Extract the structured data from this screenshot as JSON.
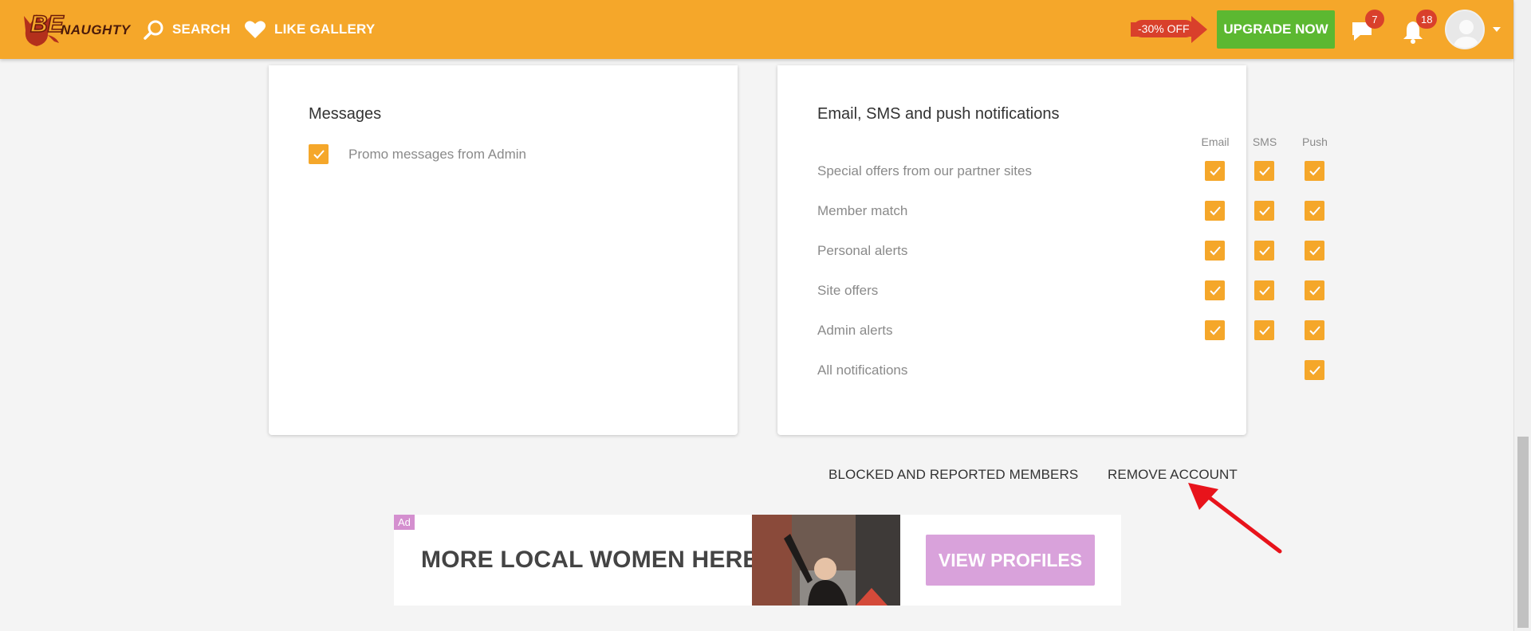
{
  "header": {
    "logo_text": "NAUGHTY",
    "logo_prefix": "BE",
    "nav": [
      {
        "label": "SEARCH",
        "icon": "search-icon"
      },
      {
        "label": "LIKE GALLERY",
        "icon": "heart-icon"
      }
    ],
    "discount": "-30% OFF",
    "upgrade_label": "UPGRADE NOW",
    "chat_count": "7",
    "notif_count": "18",
    "colors": {
      "brand": "#f5a72a",
      "upgrade": "#5cb831",
      "badge": "#d9402b"
    }
  },
  "messages_card": {
    "title": "Messages",
    "items": [
      {
        "label": "Promo messages from Admin",
        "checked": true
      }
    ]
  },
  "notifications_card": {
    "title": "Email, SMS and push notifications",
    "columns": [
      "Email",
      "SMS",
      "Push"
    ],
    "rows": [
      {
        "label": "Special offers from our partner sites",
        "email": true,
        "sms": true,
        "push": true
      },
      {
        "label": "Member match",
        "email": true,
        "sms": true,
        "push": true
      },
      {
        "label": "Personal alerts",
        "email": true,
        "sms": true,
        "push": true
      },
      {
        "label": "Site offers",
        "email": true,
        "sms": true,
        "push": true
      },
      {
        "label": "Admin alerts",
        "email": true,
        "sms": true,
        "push": true
      },
      {
        "label": "All notifications",
        "email": null,
        "sms": null,
        "push": true
      }
    ]
  },
  "footer_links": {
    "blocked": "BLOCKED AND REPORTED MEMBERS",
    "remove": "REMOVE ACCOUNT"
  },
  "ad": {
    "tag": "Ad",
    "text": "MORE LOCAL WOMEN HERE",
    "button": "VIEW PROFILES"
  }
}
